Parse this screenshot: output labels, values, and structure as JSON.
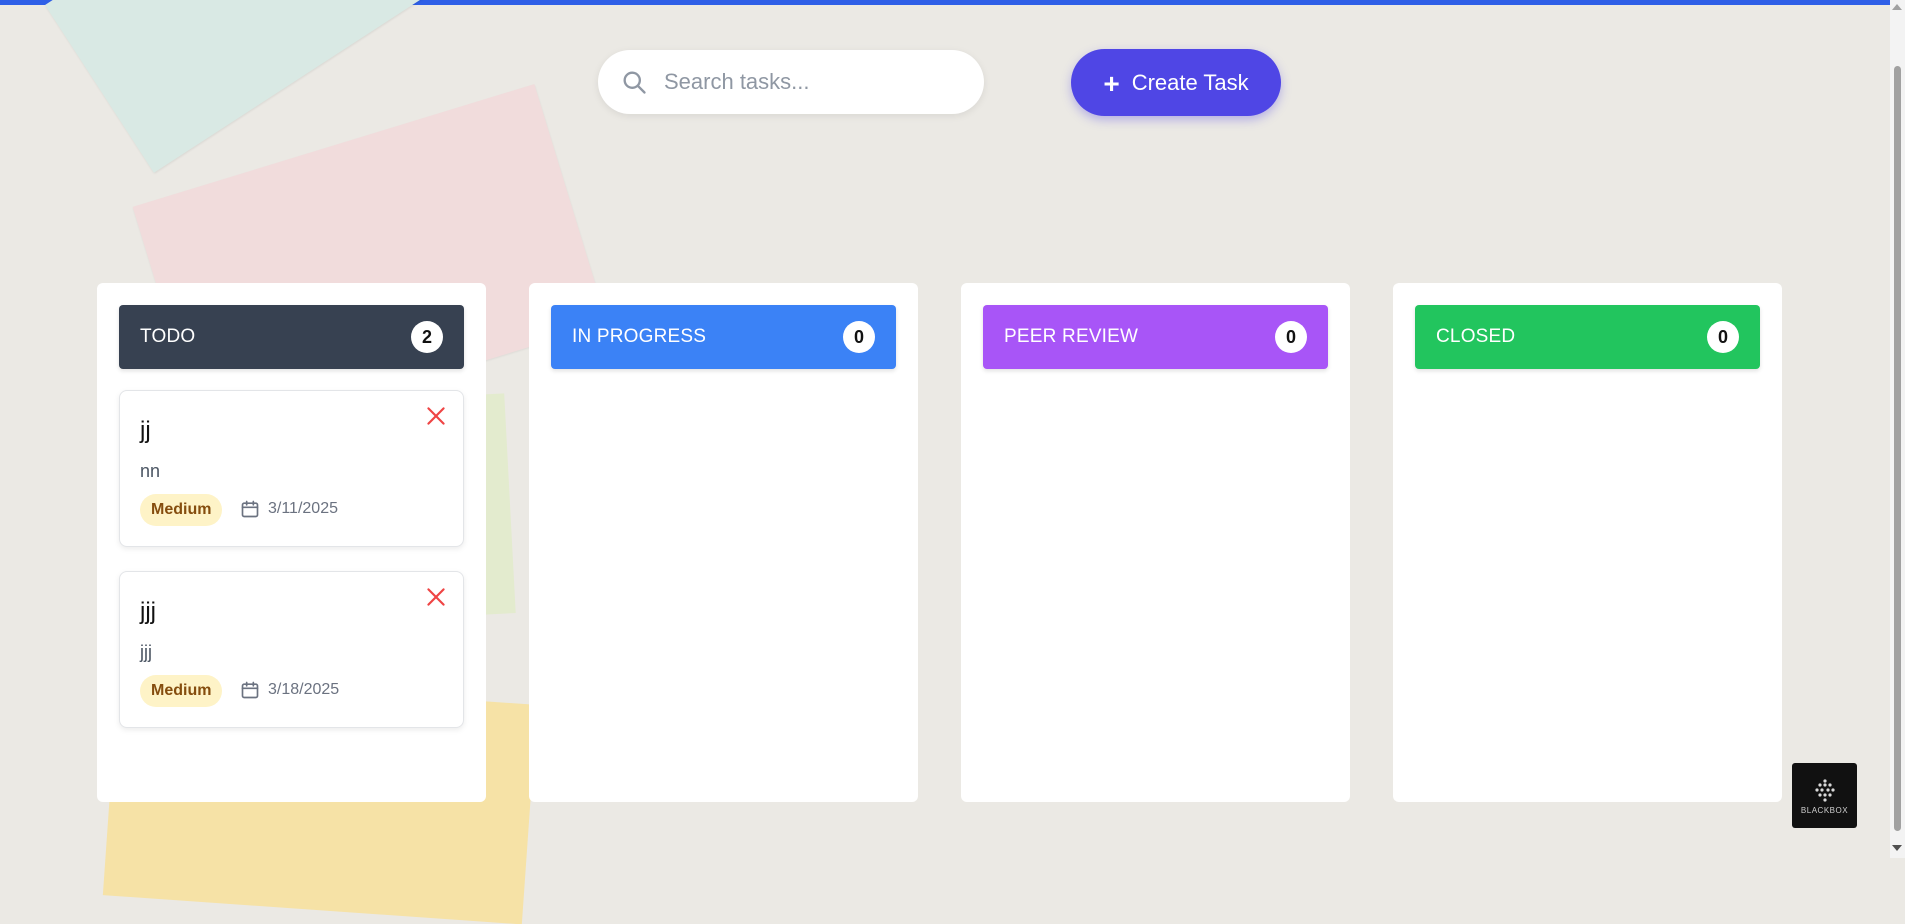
{
  "search": {
    "placeholder": "Search tasks..."
  },
  "create_button": {
    "icon": "+",
    "label": "Create Task"
  },
  "columns": [
    {
      "title": "TODO",
      "count": "2",
      "color": "#374151",
      "tasks": [
        {
          "title": "jj",
          "description": "nn",
          "priority": "Medium",
          "due_date": "3/11/2025"
        },
        {
          "title": "jjj",
          "description": "jjj",
          "priority": "Medium",
          "due_date": "3/18/2025"
        }
      ]
    },
    {
      "title": "IN PROGRESS",
      "count": "0",
      "color": "#3b82f6",
      "tasks": []
    },
    {
      "title": "PEER REVIEW",
      "count": "0",
      "color": "#a855f7",
      "tasks": []
    },
    {
      "title": "CLOSED",
      "count": "0",
      "color": "#22c55e",
      "tasks": []
    }
  ],
  "widget": {
    "label": "BLACKBOX"
  }
}
